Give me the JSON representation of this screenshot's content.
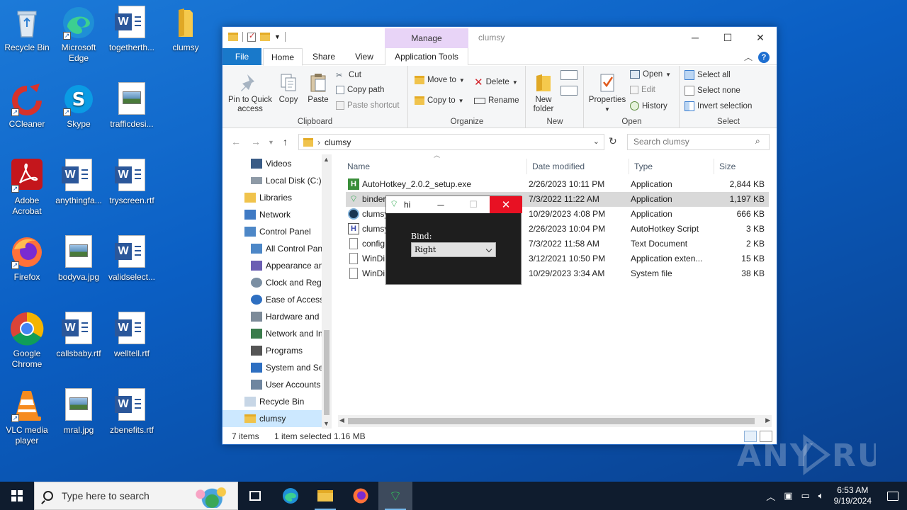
{
  "desktop": {
    "icons": [
      {
        "label": "Recycle Bin"
      },
      {
        "label": "Microsoft Edge"
      },
      {
        "label": "togetherth..."
      },
      {
        "label": "clumsy"
      },
      {
        "label": "CCleaner"
      },
      {
        "label": "Skype"
      },
      {
        "label": "trafficdesi..."
      },
      {
        "label": "Adobe Acrobat"
      },
      {
        "label": "anythingfa..."
      },
      {
        "label": "tryscreen.rtf"
      },
      {
        "label": "Firefox"
      },
      {
        "label": "bodyva.jpg"
      },
      {
        "label": "validselect..."
      },
      {
        "label": "Google Chrome"
      },
      {
        "label": "callsbaby.rtf"
      },
      {
        "label": "welltell.rtf"
      },
      {
        "label": "VLC media player"
      },
      {
        "label": "mral.jpg"
      },
      {
        "label": "zbenefits.rtf"
      }
    ]
  },
  "explorer": {
    "title": "clumsy",
    "manage_tab": "Manage",
    "tabs": {
      "file": "File",
      "home": "Home",
      "share": "Share",
      "view": "View",
      "app_tools": "Application Tools"
    },
    "ribbon": {
      "clipboard": {
        "label": "Clipboard",
        "pin": "Pin to Quick access",
        "copy": "Copy",
        "paste": "Paste",
        "cut": "Cut",
        "copy_path": "Copy path",
        "paste_shortcut": "Paste shortcut"
      },
      "organize": {
        "label": "Organize",
        "move_to": "Move to",
        "copy_to": "Copy to",
        "delete": "Delete",
        "rename": "Rename"
      },
      "new": {
        "label": "New",
        "new_folder": "New folder"
      },
      "open": {
        "label": "Open",
        "properties": "Properties",
        "open": "Open",
        "edit": "Edit",
        "history": "History"
      },
      "select": {
        "label": "Select",
        "select_all": "Select all",
        "select_none": "Select none",
        "invert": "Invert selection"
      }
    },
    "address": {
      "path": "clumsy",
      "search_placeholder": "Search clumsy"
    },
    "nav": [
      {
        "label": "Videos"
      },
      {
        "label": "Local Disk (C:)"
      },
      {
        "label": "Libraries"
      },
      {
        "label": "Network"
      },
      {
        "label": "Control Panel"
      },
      {
        "label": "All Control Panel Items"
      },
      {
        "label": "Appearance and Personalization"
      },
      {
        "label": "Clock and Region"
      },
      {
        "label": "Ease of Access"
      },
      {
        "label": "Hardware and Sound"
      },
      {
        "label": "Network and Internet"
      },
      {
        "label": "Programs"
      },
      {
        "label": "System and Security"
      },
      {
        "label": "User Accounts"
      },
      {
        "label": "Recycle Bin"
      },
      {
        "label": "clumsy"
      }
    ],
    "columns": {
      "name": "Name",
      "date": "Date modified",
      "type": "Type",
      "size": "Size"
    },
    "files": [
      {
        "name": "AutoHotkey_2.0.2_setup.exe",
        "date": "2/26/2023 10:11 PM",
        "type": "Application",
        "size": "2,844 KB"
      },
      {
        "name": "binder",
        "date": "7/3/2022 11:22 AM",
        "type": "Application",
        "size": "1,197 KB"
      },
      {
        "name": "clumsy",
        "date": "10/29/2023 4:08 PM",
        "type": "Application",
        "size": "666 KB"
      },
      {
        "name": "clumsy",
        "date": "2/26/2023 10:04 PM",
        "type": "AutoHotkey Script",
        "size": "3 KB"
      },
      {
        "name": "config",
        "date": "7/3/2022 11:58 AM",
        "type": "Text Document",
        "size": "2 KB"
      },
      {
        "name": "WinDi",
        "date": "3/12/2021 10:50 PM",
        "type": "Application exten...",
        "size": "15 KB"
      },
      {
        "name": "WinDi",
        "date": "10/29/2023 3:34 AM",
        "type": "System file",
        "size": "38 KB"
      }
    ],
    "status": {
      "items": "7 items",
      "selected": "1 item selected",
      "size": "1.16 MB"
    }
  },
  "popup": {
    "title": "hi",
    "bind_label": "Bind:",
    "bind_value": "Right"
  },
  "watermark": "ANY RUN",
  "taskbar": {
    "search_placeholder": "Type here to search",
    "time": "6:53 AM",
    "date": "9/19/2024"
  },
  "colors": {
    "desktop": "#0b5fc4",
    "file_tab": "#1979ca",
    "manage_tab": "#e8d4f7",
    "selection": "#cce8ff",
    "close_red": "#e81123",
    "taskbar": "#0f1c2e"
  }
}
